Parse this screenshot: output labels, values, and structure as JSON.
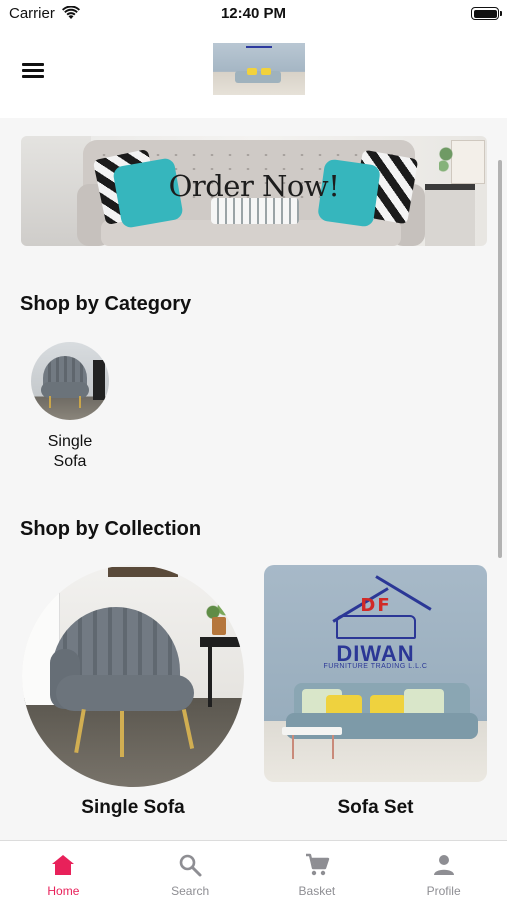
{
  "status_bar": {
    "carrier": "Carrier",
    "time": "12:40 PM"
  },
  "header": {
    "menu_icon": "hamburger-menu-icon",
    "logo_alt": "Diwan Furniture logo"
  },
  "banner": {
    "text": "Order Now!"
  },
  "shop_by_category": {
    "title": "Shop by Category",
    "items": [
      {
        "label": "Single\nSofa"
      }
    ]
  },
  "shop_by_collection": {
    "title": "Shop by Collection",
    "items": [
      {
        "label": "Single Sofa"
      },
      {
        "label": "Sofa Set"
      }
    ],
    "logo_text": {
      "df": "DF",
      "diwan": "DIWAN",
      "trading": "FURNITURE TRADING L.L.C"
    }
  },
  "tabbar": {
    "tabs": [
      {
        "label": "Home",
        "icon": "home-icon",
        "active": true
      },
      {
        "label": "Search",
        "icon": "search-icon",
        "active": false
      },
      {
        "label": "Basket",
        "icon": "cart-icon",
        "active": false
      },
      {
        "label": "Profile",
        "icon": "person-icon",
        "active": false
      }
    ]
  },
  "colors": {
    "accent": "#e8215a",
    "inactive": "#8e8e93",
    "background": "#f6f6f6"
  }
}
